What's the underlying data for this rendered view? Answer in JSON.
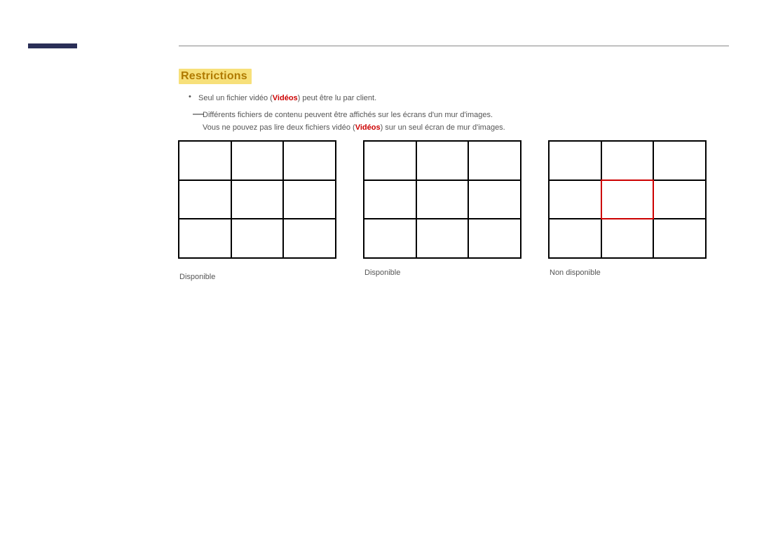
{
  "heading": "Restrictions",
  "bullet": {
    "line1_a": "Seul un fichier vidéo (",
    "line1_videos": "Vidéos",
    "line1_b": ") peut être lu par client."
  },
  "dash": {
    "line1": "Différents fichiers de contenu peuvent être affichés sur les écrans d'un mur d'images.",
    "line2_a": "Vous ne pouvez pas lire deux fichiers vidéo (",
    "line2_videos": "Vidéos",
    "line2_b": ") sur un seul écran de mur d'images."
  },
  "captions": {
    "grid1": "Disponible",
    "grid2": "Disponible",
    "grid3": "Non disponible"
  }
}
